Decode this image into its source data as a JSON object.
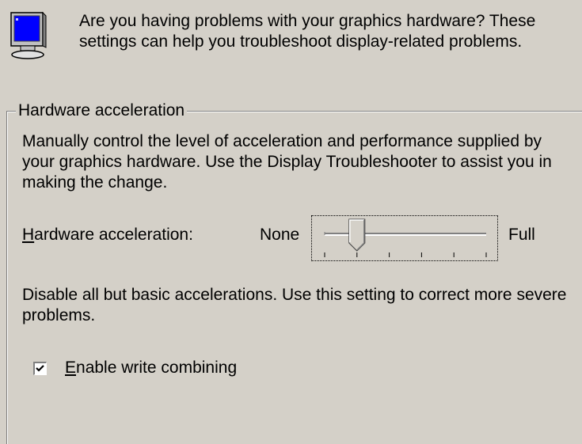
{
  "intro": {
    "icon": "monitor-icon",
    "text": "Are you having problems with your graphics hardware? These settings can help you troubleshoot display-related problems."
  },
  "hardware_group": {
    "title": "Hardware acceleration",
    "description": " Manually control the level of acceleration and performance supplied by your graphics hardware. Use the Display Troubleshooter to assist you in making the change.",
    "slider": {
      "label_access_key": "H",
      "label_rest": "ardware acceleration:",
      "min_label": "None",
      "max_label": "Full",
      "position": 1,
      "steps": 6
    },
    "help_text": "Disable all but basic accelerations. Use this setting to correct more severe problems.",
    "write_combining": {
      "checked": true,
      "label_access_key": "E",
      "label_rest": "nable write combining"
    }
  }
}
